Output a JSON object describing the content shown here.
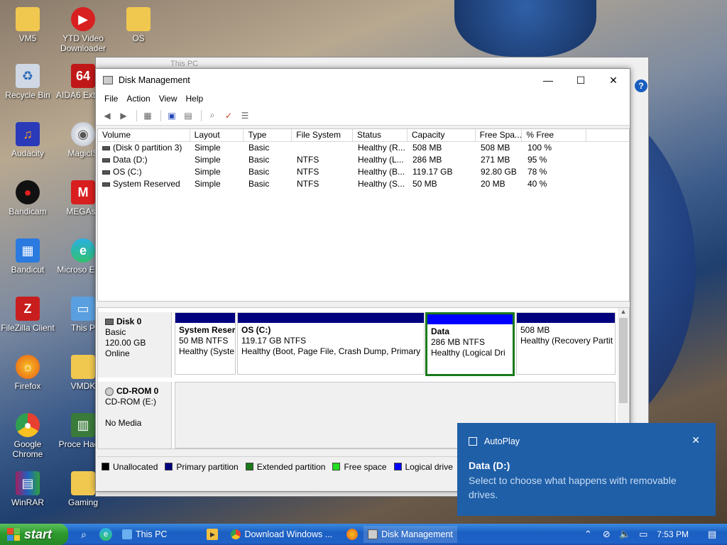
{
  "desktop": {
    "icons_col1": [
      {
        "label": "VM5",
        "icon": "folder-icon"
      },
      {
        "label": "Recycle Bin",
        "icon": "recycle-bin-icon"
      },
      {
        "label": "Audacity",
        "icon": "audacity-icon"
      },
      {
        "label": "Bandicam",
        "icon": "bandicam-icon"
      },
      {
        "label": "Bandicut",
        "icon": "bandicut-icon"
      },
      {
        "label": "FileZilla Client",
        "icon": "filezilla-icon"
      },
      {
        "label": "Firefox",
        "icon": "firefox-icon"
      },
      {
        "label": "Google Chrome",
        "icon": "chrome-icon"
      },
      {
        "label": "WinRAR",
        "icon": "winrar-icon"
      }
    ],
    "icons_col2": [
      {
        "label": "YTD Video Downloader",
        "icon": "ytd-icon"
      },
      {
        "label": "AIDA6 Extrem",
        "icon": "aida64-icon"
      },
      {
        "label": "MagicIS",
        "icon": "magiciso-icon"
      },
      {
        "label": "MEGAsy",
        "icon": "mega-icon"
      },
      {
        "label": "Microso Edge",
        "icon": "edge-icon"
      },
      {
        "label": "This P",
        "icon": "this-pc-icon"
      },
      {
        "label": "VMDK",
        "icon": "folder-icon"
      },
      {
        "label": "Proce Hacke",
        "icon": "process-hacker-icon"
      },
      {
        "label": "Gaming",
        "icon": "folder-icon"
      }
    ],
    "icons_col3": [
      {
        "label": "OS",
        "icon": "folder-icon"
      }
    ]
  },
  "bg_window": {
    "title": "This PC"
  },
  "window": {
    "title": "Disk Management",
    "menu": [
      "File",
      "Action",
      "View",
      "Help"
    ],
    "columns": [
      "Volume",
      "Layout",
      "Type",
      "File System",
      "Status",
      "Capacity",
      "Free Spa...",
      "% Free"
    ],
    "volumes": [
      [
        "(Disk 0 partition 3)",
        "Simple",
        "Basic",
        "",
        "Healthy (R...",
        "508 MB",
        "508 MB",
        "100 %"
      ],
      [
        "Data (D:)",
        "Simple",
        "Basic",
        "NTFS",
        "Healthy (L...",
        "286 MB",
        "271 MB",
        "95 %"
      ],
      [
        "OS (C:)",
        "Simple",
        "Basic",
        "NTFS",
        "Healthy (B...",
        "119.17 GB",
        "92.80 GB",
        "78 %"
      ],
      [
        "System Reserved",
        "Simple",
        "Basic",
        "NTFS",
        "Healthy (S...",
        "50 MB",
        "20 MB",
        "40 %"
      ]
    ],
    "disk0": {
      "name": "Disk 0",
      "type": "Basic",
      "size": "120.00 GB",
      "state": "Online",
      "partitions": [
        {
          "name": "System Reser",
          "size": "50 MB NTFS",
          "status": "Healthy (Syste"
        },
        {
          "name": "OS  (C:)",
          "size": "119.17 GB NTFS",
          "status": "Healthy (Boot, Page File, Crash Dump, Primary"
        },
        {
          "name": "Data",
          "size": "286 MB NTFS",
          "status": "Healthy (Logical Dri"
        },
        {
          "name": "",
          "size": "508 MB",
          "status": "Healthy (Recovery Partit"
        }
      ]
    },
    "cdrom0": {
      "name": "CD-ROM 0",
      "device": "CD-ROM (E:)",
      "media": "No Media"
    },
    "legend": [
      {
        "label": "Unallocated",
        "color": "#000000"
      },
      {
        "label": "Primary partition",
        "color": "#00007f"
      },
      {
        "label": "Extended partition",
        "color": "#1a7a1a"
      },
      {
        "label": "Free space",
        "color": "#22dd22"
      },
      {
        "label": "Logical drive",
        "color": "#0000ff"
      }
    ]
  },
  "toast": {
    "app": "AutoPlay",
    "title": "Data (D:)",
    "message": "Select to choose what happens with removable drives."
  },
  "taskbar": {
    "start": "start",
    "tasks": [
      "This PC",
      "Download Windows ...",
      "Disk Management"
    ],
    "time": "7:53 PM"
  }
}
